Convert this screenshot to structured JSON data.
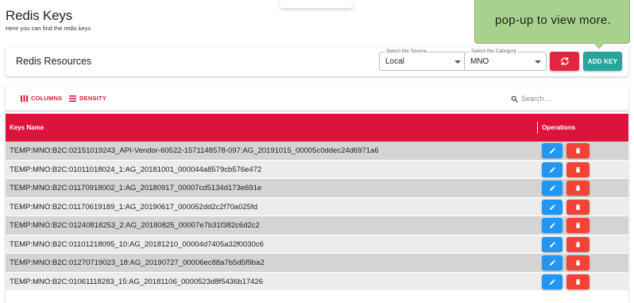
{
  "header": {
    "title": "Redis Keys",
    "subtitle": "Here you can find the redis keys"
  },
  "callout": {
    "text": "pop-up to view more.",
    "color": "#a9d18e"
  },
  "resources": {
    "title": "Redis Resources",
    "source": {
      "label": "Select the Source",
      "value": "Local"
    },
    "category": {
      "label": "Select the Category",
      "value": "MNO"
    },
    "refresh_icon": "refresh-icon",
    "add_key_label": "ADD KEY"
  },
  "toolbar": {
    "columns_label": "COLUMNS",
    "density_label": "DENSITY",
    "search_placeholder": "Search…"
  },
  "table": {
    "columns": [
      "Keys Name",
      "Operations"
    ],
    "header_color": "#dc143c",
    "rows": [
      "TEMP:MNO:B2C:02151019243_API-Vendor-60522-1571148578-097:AG_20191015_00005c0ddec24d6971a6",
      "TEMP:MNO:B2C:01011018024_1:AG_20181001_000044a8579cb576e472",
      "TEMP:MNO:B2C:01170918002_1:AG_20180917_00007cd5134d173e691e",
      "TEMP:MNO:B2C:01170619189_1:AG_20190617_000052dd2c2f70a025fd",
      "TEMP:MNO:B2C:01240818253_2:AG_20180825_00007e7b31f382c6d2c2",
      "TEMP:MNO:B2C:01101218095_10:AG_20181210_00004d7405a32f0030c6",
      "TEMP:MNO:B2C:01270719023_18:AG_20190727_00006ec88a7b5d5f9ba2",
      "TEMP:MNO:B2C:01061118283_15:AG_20181106_0000523d8f5436b17426"
    ],
    "edit_color": "#2196f3",
    "delete_color": "#f44336"
  }
}
